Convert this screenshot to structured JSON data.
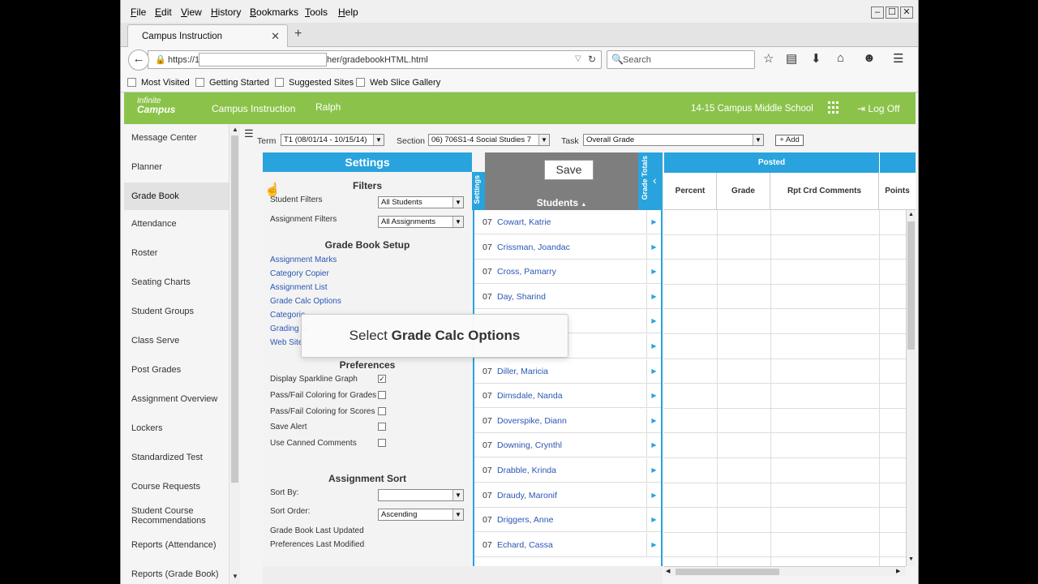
{
  "browser": {
    "menu": [
      "File",
      "Edit",
      "View",
      "History",
      "Bookmarks",
      "Tools",
      "Help"
    ],
    "tab_title": "Campus Instruction",
    "url_prefix": "https://1",
    "url_suffix": "her/gradebookHTML.html",
    "search_placeholder": "Search",
    "bookmarks": [
      "Most Visited",
      "Getting Started",
      "Suggested Sites",
      "Web Slice Gallery"
    ]
  },
  "app": {
    "logo_top": "Infinite",
    "logo_bottom": "Campus",
    "title": "Campus Instruction",
    "user": "Ralph",
    "school": "14-15 Campus Middle School",
    "logoff": "Log Off"
  },
  "nav": {
    "items": [
      "Message Center",
      "Planner",
      "Grade Book",
      "Attendance",
      "Roster",
      "Seating Charts",
      "Student Groups",
      "Class Serve",
      "Post Grades",
      "Assignment Overview",
      "Lockers",
      "Standardized Test",
      "Course Requests",
      "Student Course Recommendations",
      "Reports (Attendance)",
      "Reports (Grade Book)"
    ],
    "active": "Grade Book"
  },
  "filters_bar": {
    "term_label": "Term",
    "term_value": "T1 (08/01/14 - 10/15/14)",
    "section_label": "Section",
    "section_value": "06) 706S1-4 Social Studies 7",
    "task_label": "Task",
    "task_value": "Overall Grade",
    "add_label": "+ Add"
  },
  "settings": {
    "header": "Settings",
    "filters_heading": "Filters",
    "student_filters_label": "Student Filters",
    "student_filters_value": "All Students",
    "assignment_filters_label": "Assignment Filters",
    "assignment_filters_value": "All Assignments",
    "setup_heading": "Grade Book Setup",
    "setup_links": [
      "Assignment Marks",
      "Category Copier",
      "Assignment List",
      "Grade Calc Options",
      "Categorie",
      "Grading S",
      "Web Site"
    ],
    "preferences_heading": "Preferences",
    "preferences": [
      {
        "label": "Display Sparkline Graph",
        "checked": true
      },
      {
        "label": "Pass/Fail Coloring for Grades",
        "checked": false
      },
      {
        "label": "Pass/Fail Coloring for Scores",
        "checked": false
      },
      {
        "label": "Save Alert",
        "checked": false
      },
      {
        "label": "Use Canned Comments",
        "checked": false
      }
    ],
    "sort_heading": "Assignment Sort",
    "sort_by_label": "Sort By:",
    "sort_by_value": "",
    "sort_order_label": "Sort Order:",
    "sort_order_value": "Ascending",
    "last_updated_label": "Grade Book Last Updated",
    "prefs_modified_label": "Preferences Last Modified",
    "vertical_tab": "Settings"
  },
  "students": {
    "save_label": "Save",
    "header": "Students",
    "sort_indicator": "▲",
    "grade_totals_tab": "Grade Totals",
    "rows": [
      {
        "grade": "07",
        "name": "Cowart, Katrie"
      },
      {
        "grade": "07",
        "name": "Crissman, Joandac"
      },
      {
        "grade": "07",
        "name": "Cross, Pamarry"
      },
      {
        "grade": "07",
        "name": "Day, Sharind"
      },
      {
        "grade": "",
        "name": ""
      },
      {
        "grade": "",
        "name": ""
      },
      {
        "grade": "07",
        "name": "Diller, Maricia"
      },
      {
        "grade": "07",
        "name": "Dimsdale, Nanda"
      },
      {
        "grade": "07",
        "name": "Doverspike, Diann"
      },
      {
        "grade": "07",
        "name": "Downing, Crynthl"
      },
      {
        "grade": "07",
        "name": "Drabble, Krinda"
      },
      {
        "grade": "07",
        "name": "Draudy, Maronif"
      },
      {
        "grade": "07",
        "name": "Driggers, Anne"
      },
      {
        "grade": "07",
        "name": "Echard, Cassa"
      }
    ]
  },
  "posted": {
    "header": "Posted",
    "columns": [
      "Percent",
      "Grade",
      "Rpt Crd Comments",
      "Points"
    ]
  },
  "tooltip": {
    "prefix": "Select ",
    "bold": "Grade Calc Options"
  }
}
